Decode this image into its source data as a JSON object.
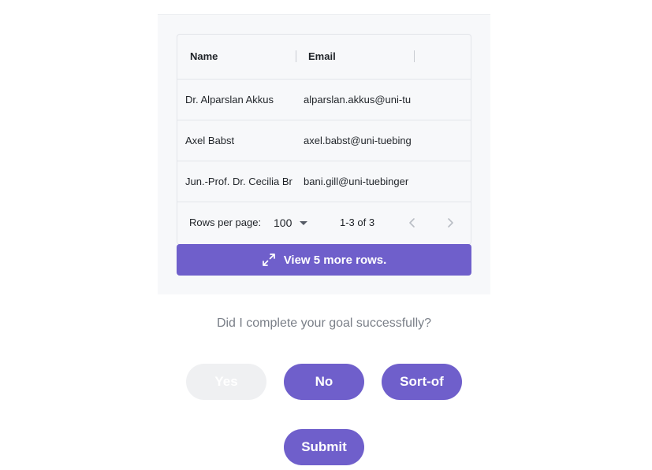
{
  "table": {
    "columns": {
      "name": "Name",
      "email": "Email"
    },
    "rows": [
      {
        "name": "Dr. Alparslan Akkus",
        "email": "alparslan.akkus@uni-tu"
      },
      {
        "name": "Axel Babst",
        "email": "axel.babst@uni-tuebing"
      },
      {
        "name": "Jun.-Prof. Dr. Cecilia Br",
        "email": "bani.gill@uni-tuebinger"
      }
    ],
    "footer": {
      "rows_per_page_label": "Rows per page:",
      "rows_per_page_value": "100",
      "range_text": "1-3 of 3"
    },
    "view_more_label": "View 5 more rows."
  },
  "feedback": {
    "question": "Did I complete your goal successfully?",
    "yes_label": "Yes",
    "no_label": "No",
    "sortof_label": "Sort-of",
    "submit_label": "Submit"
  },
  "colors": {
    "accent": "#6f5fcb",
    "disabled": "#eff0f2",
    "muted_text": "#7a7f88"
  },
  "icons": {
    "expand": "expand-arrows-icon",
    "prev": "chevron-left-icon",
    "next": "chevron-right-icon",
    "caret": "caret-down-icon"
  }
}
